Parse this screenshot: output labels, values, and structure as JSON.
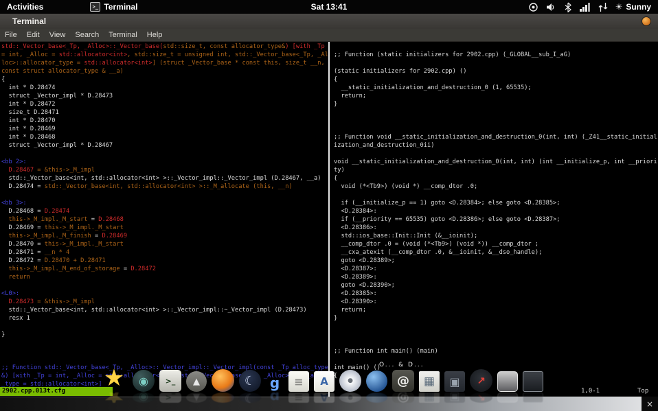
{
  "topbar": {
    "activities": "Activities",
    "app_name": "Terminal",
    "clock": "Sat 13:41",
    "weather": "Sunny",
    "status_icons": [
      "orb-icon",
      "volume-icon",
      "bluetooth-icon",
      "signal-strength-icon",
      "network-icon",
      "weather-sun-icon"
    ]
  },
  "window": {
    "title": "Terminal",
    "menus": [
      "File",
      "Edit",
      "View",
      "Search",
      "Terminal",
      "Help"
    ]
  },
  "colors": {
    "text": "#d9d9d9",
    "red": "#cf2b2b",
    "orange": "#ad6418",
    "blue": "#4343dd",
    "green_bar": "#79bc00"
  },
  "terminal": {
    "left_pane": {
      "lines": [
        [
          [
            "red",
            "std::_Vector_base<_Tp, _Alloc>::_Vector_base("
          ],
          [
            "orange",
            "std::size_t, const allocator_type&"
          ],
          [
            "red",
            ") [with _Tp"
          ]
        ],
        [
          [
            "orange",
            "= int, _Alloc = "
          ],
          [
            "red",
            "std::allocator<int>"
          ],
          [
            "orange",
            ", std::size_t = unsigned int, std::_Vector_base<_Tp, _Al"
          ]
        ],
        [
          [
            "orange",
            "loc>::allocator_type = "
          ],
          [
            "red",
            "std::allocator<int>"
          ],
          [
            "orange",
            "] (struct _Vector_base * const this, size_t __n,"
          ]
        ],
        [
          [
            "orange",
            "const struct allocator_type & __a)"
          ]
        ],
        [
          [
            "text",
            "{"
          ]
        ],
        [
          [
            "text",
            "  int * D.28474"
          ]
        ],
        [
          [
            "text",
            "  struct _Vector_impl * D.28473"
          ]
        ],
        [
          [
            "text",
            "  int * D.28472"
          ]
        ],
        [
          [
            "text",
            "  size_t D.28471"
          ]
        ],
        [
          [
            "text",
            "  int * D.28470"
          ]
        ],
        [
          [
            "text",
            "  int * D.28469"
          ]
        ],
        [
          [
            "text",
            "  int * D.28468"
          ]
        ],
        [
          [
            "text",
            "  struct _Vector_impl * D.28467"
          ]
        ],
        [],
        [
          [
            "blue",
            "<bb 2>:"
          ]
        ],
        [
          [
            "red",
            "  D.28467"
          ],
          [
            "orange",
            " = &this->_M_impl"
          ]
        ],
        [
          [
            "text",
            "  std::_Vector_base<int, std::allocator<int> >::_Vector_impl::_Vector_impl (D.28467, __a)"
          ]
        ],
        [
          [
            "text",
            "  D.28474 = "
          ],
          [
            "orange",
            "std::_Vector_base<int, std::allocator<int> >::_M_allocate (this, __n)"
          ]
        ],
        [],
        [
          [
            "blue",
            "<bb 3>:"
          ]
        ],
        [
          [
            "text",
            "  D.28468 = "
          ],
          [
            "red",
            "D.28474"
          ]
        ],
        [
          [
            "orange",
            "  this->_M_impl._M_start"
          ],
          [
            "text",
            " = "
          ],
          [
            "red",
            "D.28468"
          ]
        ],
        [
          [
            "text",
            "  D.28469 = "
          ],
          [
            "orange",
            "this->_M_impl._M_start"
          ]
        ],
        [
          [
            "orange",
            "  this->_M_impl._M_finish"
          ],
          [
            "text",
            " = "
          ],
          [
            "red",
            "D.28469"
          ]
        ],
        [
          [
            "text",
            "  D.28470 = "
          ],
          [
            "orange",
            "this->_M_impl._M_start"
          ]
        ],
        [
          [
            "text",
            "  D.28471 = "
          ],
          [
            "orange",
            "__n * 4"
          ]
        ],
        [
          [
            "text",
            "  D.28472 = "
          ],
          [
            "orange",
            "D.28470 + D.28471"
          ]
        ],
        [
          [
            "orange",
            "  this->_M_impl._M_end_of_storage"
          ],
          [
            "text",
            " = "
          ],
          [
            "red",
            "D.28472"
          ]
        ],
        [
          [
            "orange",
            "  return"
          ]
        ],
        [],
        [
          [
            "blue",
            "<L0>:"
          ]
        ],
        [
          [
            "red",
            "  D.28473"
          ],
          [
            "orange",
            " = &this->_M_impl"
          ]
        ],
        [
          [
            "text",
            "  std::_Vector_base<int, std::allocator<int> >::_Vector_impl::~_Vector_impl (D.28473)"
          ]
        ],
        [
          [
            "text",
            "  resx 1"
          ]
        ],
        [],
        [
          [
            "text",
            "}"
          ]
        ],
        [],
        [],
        [],
        [
          [
            "blue",
            ";; Function std::_Vector_base<_Tp, _Alloc>::_Vector_impl::_Vector_impl(const _Tp_alloc_type"
          ]
        ],
        [
          [
            "blue",
            "&) [with _Tp = int, _Alloc = std::allocator<int>; std::_Vector_base<_Tp, _Alloc>::_Tp_alloc"
          ]
        ],
        [
          [
            "blue",
            "_type = std::allocator<int>]"
          ]
        ]
      ]
    },
    "right_pane": {
      "lines": [
        [],
        [
          [
            "text",
            ";; Function (static initializers for 2902.cpp) (_GLOBAL__sub_I_aG)"
          ]
        ],
        [],
        [
          [
            "text",
            "(static initializers for 2902.cpp) ()"
          ]
        ],
        [
          [
            "text",
            "{"
          ]
        ],
        [
          [
            "text",
            "  __static_initialization_and_destruction_0 (1, 65535);"
          ]
        ],
        [
          [
            "text",
            "  return;"
          ]
        ],
        [
          [
            "text",
            "}"
          ]
        ],
        [],
        [],
        [],
        [
          [
            "text",
            ";; Function void __static_initialization_and_destruction_0(int, int) (_Z41__static_initial"
          ]
        ],
        [
          [
            "text",
            "ization_and_destruction_0ii)"
          ]
        ],
        [],
        [
          [
            "text",
            "void __static_initialization_and_destruction_0(int, int) (int __initialize_p, int __priori"
          ]
        ],
        [
          [
            "text",
            "ty)"
          ]
        ],
        [
          [
            "text",
            "{"
          ]
        ],
        [
          [
            "text",
            "  void (*<Tb9>) (void *) __comp_dtor .0;"
          ]
        ],
        [],
        [
          [
            "text",
            "  if (__initialize_p == 1) goto <D.28384>; else goto <D.28385>;"
          ]
        ],
        [
          [
            "text",
            "  <D.28384>:"
          ]
        ],
        [
          [
            "text",
            "  if (__priority == 65535) goto <D.28386>; else goto <D.28387>;"
          ]
        ],
        [
          [
            "text",
            "  <D.28386>:"
          ]
        ],
        [
          [
            "text",
            "  std::ios_base::Init::Init (&__ioinit);"
          ]
        ],
        [
          [
            "text",
            "  __comp_dtor .0 = (void (*<Tb9>) (void *)) __comp_dtor ;"
          ]
        ],
        [
          [
            "text",
            "  __cxa_atexit (__comp_dtor .0, &__ioinit, &__dso_handle);"
          ]
        ],
        [
          [
            "text",
            "  goto <D.28389>;"
          ]
        ],
        [
          [
            "text",
            "  <D.28387>:"
          ]
        ],
        [
          [
            "text",
            "  <D.28389>:"
          ]
        ],
        [
          [
            "text",
            "  goto <D.28390>;"
          ]
        ],
        [
          [
            "text",
            "  <D.28385>:"
          ]
        ],
        [
          [
            "text",
            "  <D.28390>:"
          ]
        ],
        [
          [
            "text",
            "  return;"
          ]
        ],
        [
          [
            "text",
            "}"
          ]
        ],
        [],
        [],
        [],
        [
          [
            "text",
            ";; Function int main() (main)"
          ]
        ],
        [],
        [
          [
            "text",
            "int main() ()"
          ]
        ],
        [
          [
            "text",
            "{"
          ]
        ]
      ]
    }
  },
  "statusline": {
    "filename": "2902.cpp.013t.cfg",
    "ruler": "1,0-1",
    "position": "Top"
  },
  "dock": {
    "caption": "O... & D...",
    "corner_glyph": "×",
    "icons": [
      {
        "name": "star-icon",
        "glyph": "★",
        "fg": "#ffd245",
        "bg": "none",
        "round": "0",
        "size": 40,
        "fs": 34
      },
      {
        "name": "camera-lens-icon",
        "glyph": "◉",
        "fg": "#7ccfc4",
        "bg": "radial-gradient(circle at 35% 30%, #3f5c5c, #0e1a1a)",
        "round": "50%",
        "size": 32,
        "fs": 16
      },
      {
        "name": "terminal-monitor-icon",
        "glyph": ">_",
        "fg": "#1c3a1c",
        "bg": "linear-gradient(#eeeee8, #b4b4ac)",
        "round": "5px",
        "size": 32,
        "fs": 11
      },
      {
        "name": "eject-icon",
        "glyph": "▲",
        "fg": "#e8e8e8",
        "bg": "linear-gradient(#8a8a86, #55554f)",
        "round": "50%",
        "size": 30,
        "fs": 13
      },
      {
        "name": "firefox-icon",
        "glyph": "",
        "fg": "#ffffff",
        "bg": "radial-gradient(circle at 38% 32%, #ffc05c, #e87a18 55%, #24468e 95%)",
        "round": "50%",
        "size": 33,
        "fs": 14
      },
      {
        "name": "moon-icon",
        "glyph": "☾",
        "fg": "#c8d2ea",
        "bg": "radial-gradient(circle at 40% 35%, #2a3650, #0c1220)",
        "round": "50%",
        "size": 32,
        "fs": 18
      },
      {
        "name": "g-letter-icon",
        "glyph": "g",
        "fg": "#6aa6ff",
        "bg": "none",
        "round": "0",
        "size": 26,
        "fs": 20
      },
      {
        "name": "document-icon",
        "glyph": "≡",
        "fg": "#8a8a86",
        "bg": "linear-gradient(#fbfbf6, #d8d8d0)",
        "round": "3px",
        "size": 30,
        "fs": 16
      },
      {
        "name": "text-doc-icon",
        "glyph": "A",
        "fg": "#3a66a8",
        "bg": "linear-gradient(#ffffff, #e4e4dc)",
        "round": "3px",
        "size": 30,
        "fs": 15
      },
      {
        "name": "cd-disc-icon",
        "glyph": "●",
        "fg": "#6a7078",
        "bg": "radial-gradient(circle, #ffffff 10%, #c9ced8 55%, #8f95a2)",
        "round": "50%",
        "size": 32,
        "fs": 9
      },
      {
        "name": "globe-icon",
        "glyph": "",
        "fg": "#ffffff",
        "bg": "radial-gradient(circle at 35% 30%, #8cc0f0, #1c4c8c 80%)",
        "round": "50%",
        "size": 31,
        "fs": 14
      },
      {
        "name": "at-mail-icon",
        "glyph": "@",
        "fg": "#f0f0ee",
        "bg": "linear-gradient(#56564f, #32322c)",
        "round": "6px",
        "size": 32,
        "fs": 18
      },
      {
        "name": "photo-frame-icon",
        "glyph": "▦",
        "fg": "#5a6a7a",
        "bg": "linear-gradient(#f0f0ee, #cfcfc8)",
        "round": "2px",
        "size": 30,
        "fs": 17
      },
      {
        "name": "gallery-icon",
        "glyph": "▣",
        "fg": "#9aa4ae",
        "bg": "linear-gradient(#3a3e46, #22262c)",
        "round": "3px",
        "size": 30,
        "fs": 16
      },
      {
        "name": "gauge-icon",
        "glyph": "↗",
        "fg": "#e04038",
        "bg": "radial-gradient(circle at 50% 40%, #2e3238, #101216)",
        "round": "50%",
        "size": 33,
        "fs": 15
      },
      {
        "name": "glass-icon",
        "glyph": "",
        "fg": "#ffffff",
        "bg": "linear-gradient(rgba(255,255,255,0.8), rgba(205,205,212,0.45))",
        "round": "5px",
        "size": 30,
        "fs": 12,
        "border": "1px solid rgba(255,255,255,0.7)"
      },
      {
        "name": "dark-frame-icon",
        "glyph": "",
        "fg": "#ffffff",
        "bg": "linear-gradient(#3c4046, #191c20)",
        "round": "3px",
        "size": 30,
        "fs": 12,
        "border": "1px solid #8a8f96"
      }
    ]
  }
}
